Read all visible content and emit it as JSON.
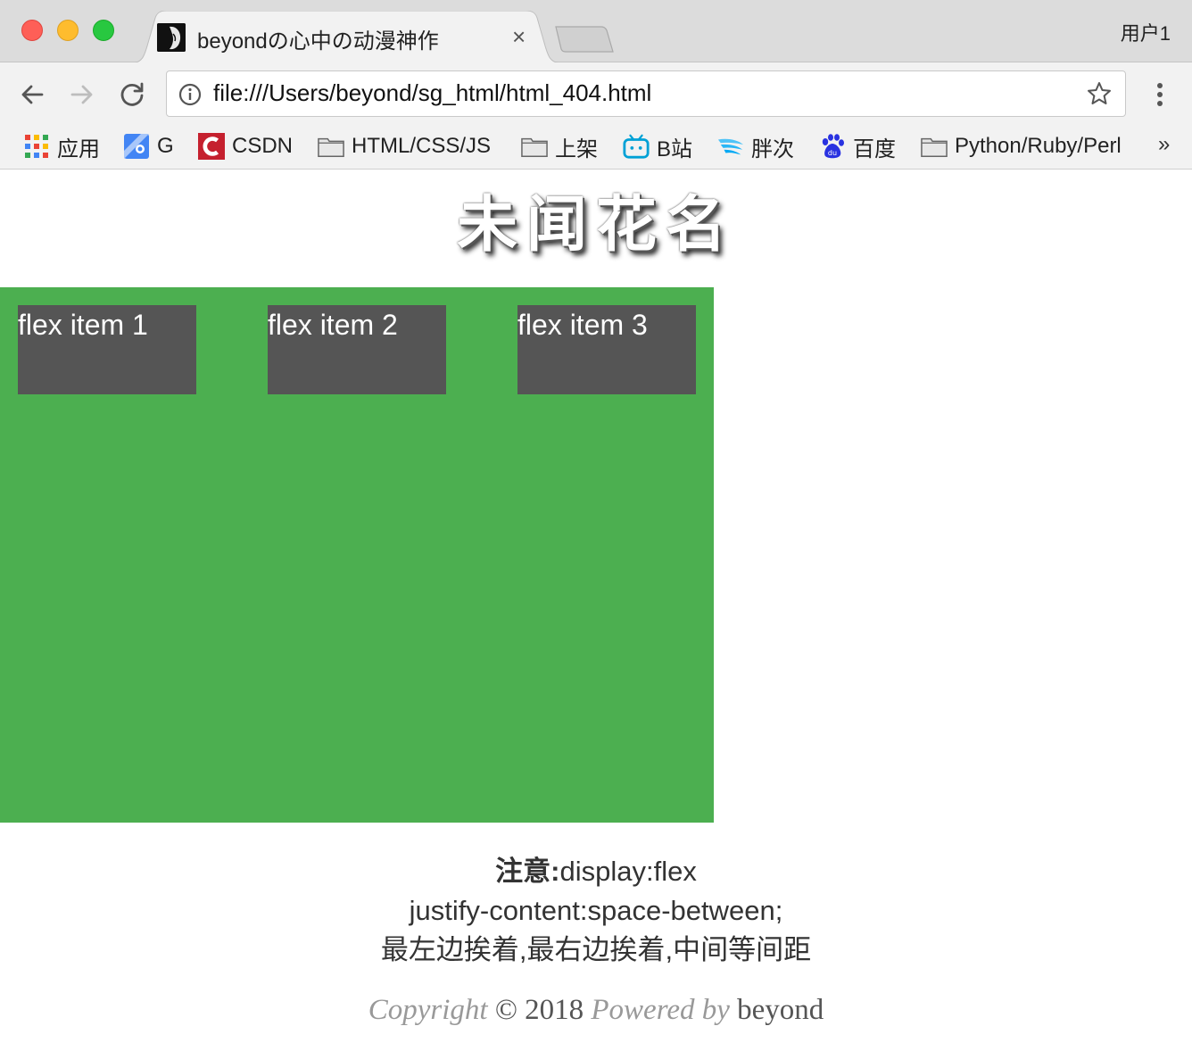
{
  "browser": {
    "tab": {
      "title": "beyondの心中の动漫神作",
      "close_glyph": "×"
    },
    "profile_label": "用户1",
    "address_bar": {
      "url": "file:///Users/beyond/sg_html/html_404.html"
    },
    "bookmarks": [
      {
        "label": "应用",
        "icon": "apps-grid-icon"
      },
      {
        "label": "G",
        "icon": "google-maps-icon"
      },
      {
        "label": "CSDN",
        "icon": "csdn-icon"
      },
      {
        "label": "HTML/CSS/JS",
        "icon": "folder-icon"
      },
      {
        "label": "上架",
        "icon": "folder-icon"
      },
      {
        "label": "B站",
        "icon": "bilibili-icon"
      },
      {
        "label": "胖次",
        "icon": "wing-icon"
      },
      {
        "label": "百度",
        "icon": "baidu-paw-icon"
      },
      {
        "label": "Python/Ruby/Perl",
        "icon": "folder-icon"
      }
    ],
    "bookmarks_overflow": "»"
  },
  "page": {
    "heading": "未闻花名",
    "flex_items": [
      {
        "label": "flex item 1"
      },
      {
        "label": "flex item 2"
      },
      {
        "label": "flex item 3"
      }
    ],
    "note": {
      "prefix": "注意:",
      "line1": "display:flex",
      "line2": "justify-content:space-between;",
      "line3": "最左边挨着,最右边挨着,中间等间距"
    },
    "copyright": {
      "copyright_word": "Copyright",
      "symbol": "©",
      "year": "2018",
      "powered_by": "Powered by",
      "author": "beyond"
    }
  },
  "colors": {
    "container_bg": "#4caf50",
    "item_bg": "#555555",
    "item_text": "#ffffff"
  }
}
